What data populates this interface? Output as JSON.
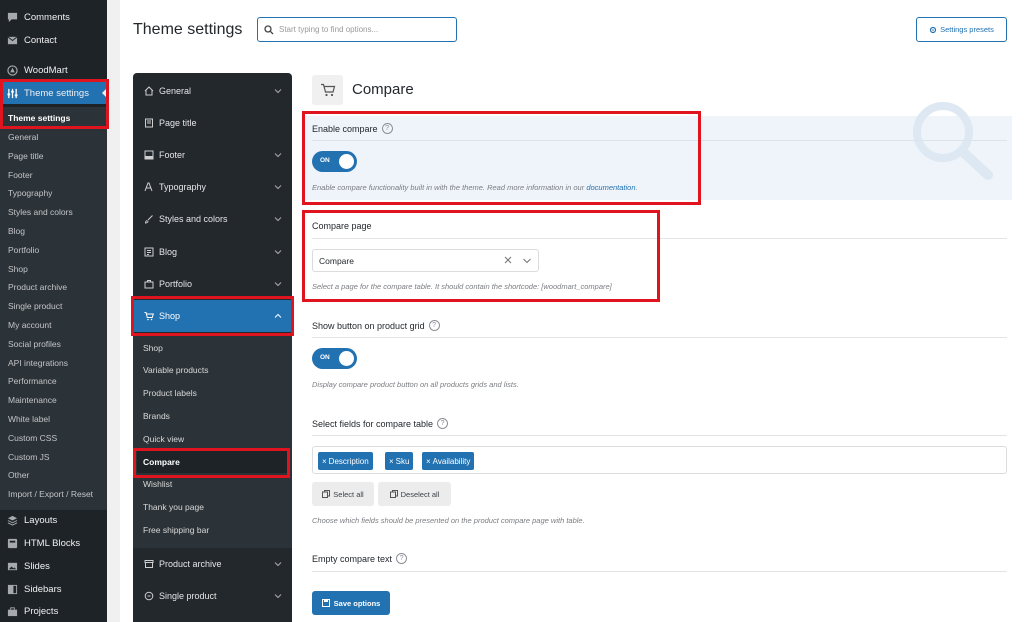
{
  "wp_menu": {
    "comments": "Comments",
    "contact": "Contact",
    "woodmart": "WoodMart",
    "theme_settings": "Theme settings",
    "layouts": "Layouts",
    "html_blocks": "HTML Blocks",
    "slides": "Slides",
    "sidebars": "Sidebars",
    "projects": "Projects"
  },
  "wp_submenu": [
    "Theme settings",
    "General",
    "Page title",
    "Footer",
    "Typography",
    "Styles and colors",
    "Blog",
    "Portfolio",
    "Shop",
    "Product archive",
    "Single product",
    "My account",
    "Social profiles",
    "API integrations",
    "Performance",
    "Maintenance",
    "White label",
    "Custom CSS",
    "Custom JS",
    "Other",
    "Import / Export / Reset"
  ],
  "header": {
    "title": "Theme settings",
    "search_placeholder": "Start typing to find options...",
    "presets_label": "Settings presets"
  },
  "theme_nav": {
    "items": [
      "General",
      "Page title",
      "Footer",
      "Typography",
      "Styles and colors",
      "Blog",
      "Portfolio",
      "Shop",
      "Product archive",
      "Single product"
    ],
    "shop_sub": [
      "Shop",
      "Variable products",
      "Product labels",
      "Brands",
      "Quick view",
      "Compare",
      "Wishlist",
      "Thank you page",
      "Free shipping bar"
    ]
  },
  "section": {
    "title": "Compare",
    "enable_label": "Enable compare",
    "enable_toggle": "ON",
    "enable_desc": "Enable compare functionality built in with the theme. Read more information in our ",
    "enable_desc_link": "documentation",
    "enable_desc_end": ".",
    "page_label": "Compare page",
    "page_value": "Compare",
    "page_desc": "Select a page for the compare table. It should contain the shortcode: [woodmart_compare]",
    "grid_label": "Show button on product grid",
    "grid_toggle": "ON",
    "grid_desc": "Display compare product button on all products grids and lists.",
    "fields_label": "Select fields for compare table",
    "fields_tags": [
      "Description",
      "Sku",
      "Availability"
    ],
    "select_all": "Select all",
    "deselect_all": "Deselect all",
    "fields_desc": "Choose which fields should be presented on the product compare page with table.",
    "empty_label": "Empty compare text",
    "save_label": "Save options",
    "help": "?"
  },
  "colors": {
    "accent": "#2271b1",
    "highlight": "#e0141e",
    "admin_bg": "#1d2327"
  }
}
